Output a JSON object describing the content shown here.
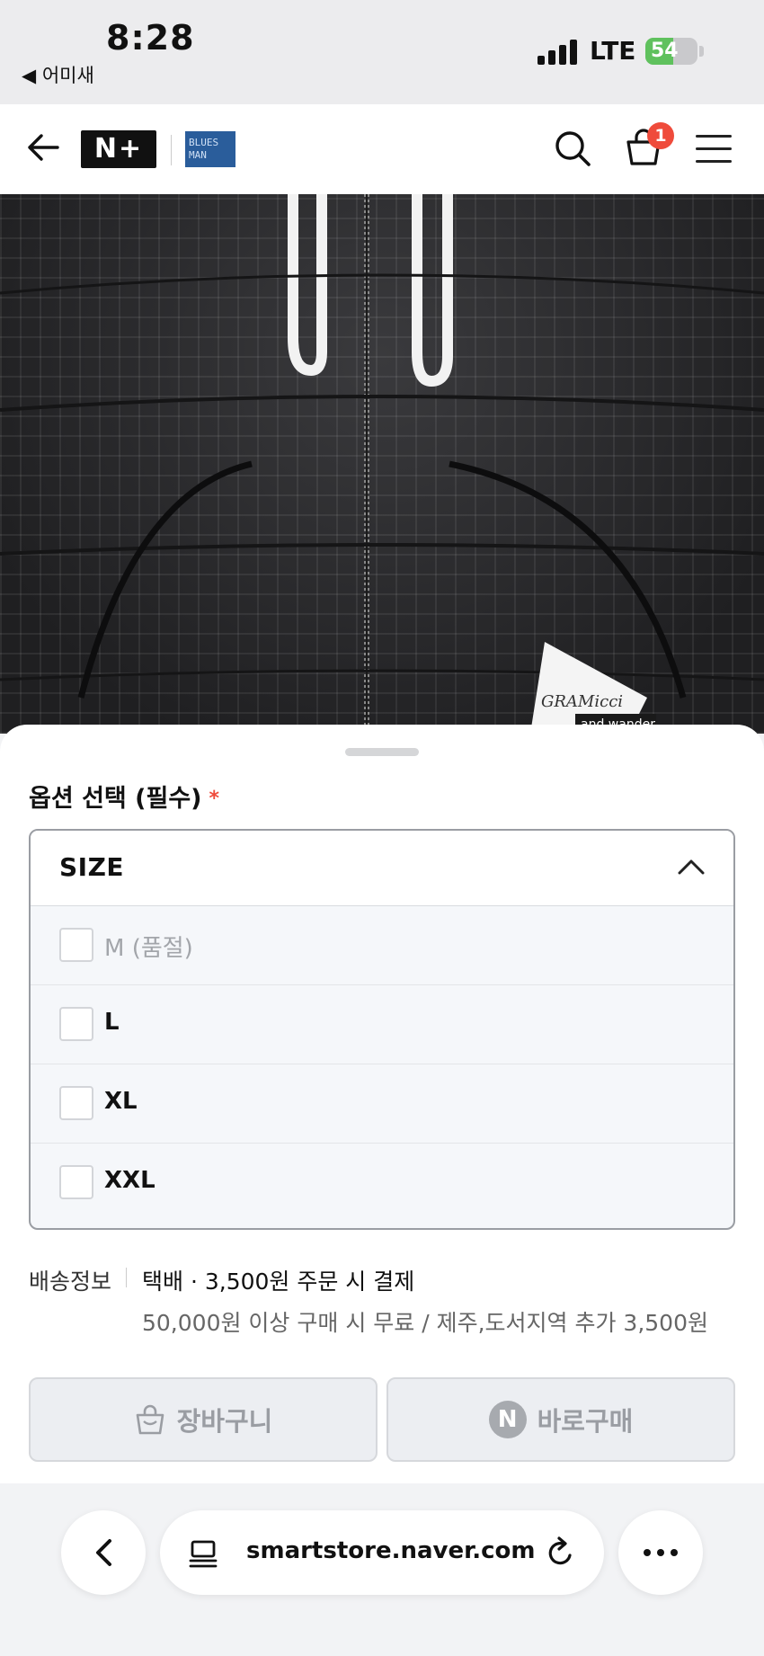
{
  "status_bar": {
    "time": "8:28",
    "back_app": "◀ 어미새",
    "network": "LTE",
    "battery": "54",
    "battery_level": 0.54,
    "battery_color": "#5fc15d"
  },
  "nav": {
    "logo_text": "N+",
    "brand_logo": "BLUES MAN",
    "cart_count": "1",
    "icons": [
      "back-arrow-icon",
      "search-icon",
      "shopping-bag-icon",
      "hamburger-menu-icon"
    ]
  },
  "product_image": {
    "print_brand": "GRAMICCI",
    "print_collab": "and wander",
    "tag_text": "GRAMicci"
  },
  "sheet": {
    "option_title": "옵션 선택 (필수)",
    "required_mark": "*",
    "dropdown": {
      "header": "SIZE",
      "expanded": true,
      "options": [
        {
          "label": "M (품절)",
          "sold_out": true
        },
        {
          "label": "L",
          "sold_out": false
        },
        {
          "label": "XL",
          "sold_out": false
        },
        {
          "label": "XXL",
          "sold_out": false
        }
      ]
    },
    "shipping": {
      "label": "배송정보",
      "main": "택배 · 3,500원 주문 시 결제",
      "sub": "50,000원 이상 구매 시 무료 / 제주,도서지역 추가 3,500원"
    },
    "buttons": {
      "cart": "장바구니",
      "buy_now": "바로구매",
      "buy_icon_letter": "N"
    }
  },
  "safari": {
    "url": "smartstore.naver.com"
  },
  "colors": {
    "accent_red": "#ef4b3b",
    "disabled_text": "#9a9da3"
  }
}
